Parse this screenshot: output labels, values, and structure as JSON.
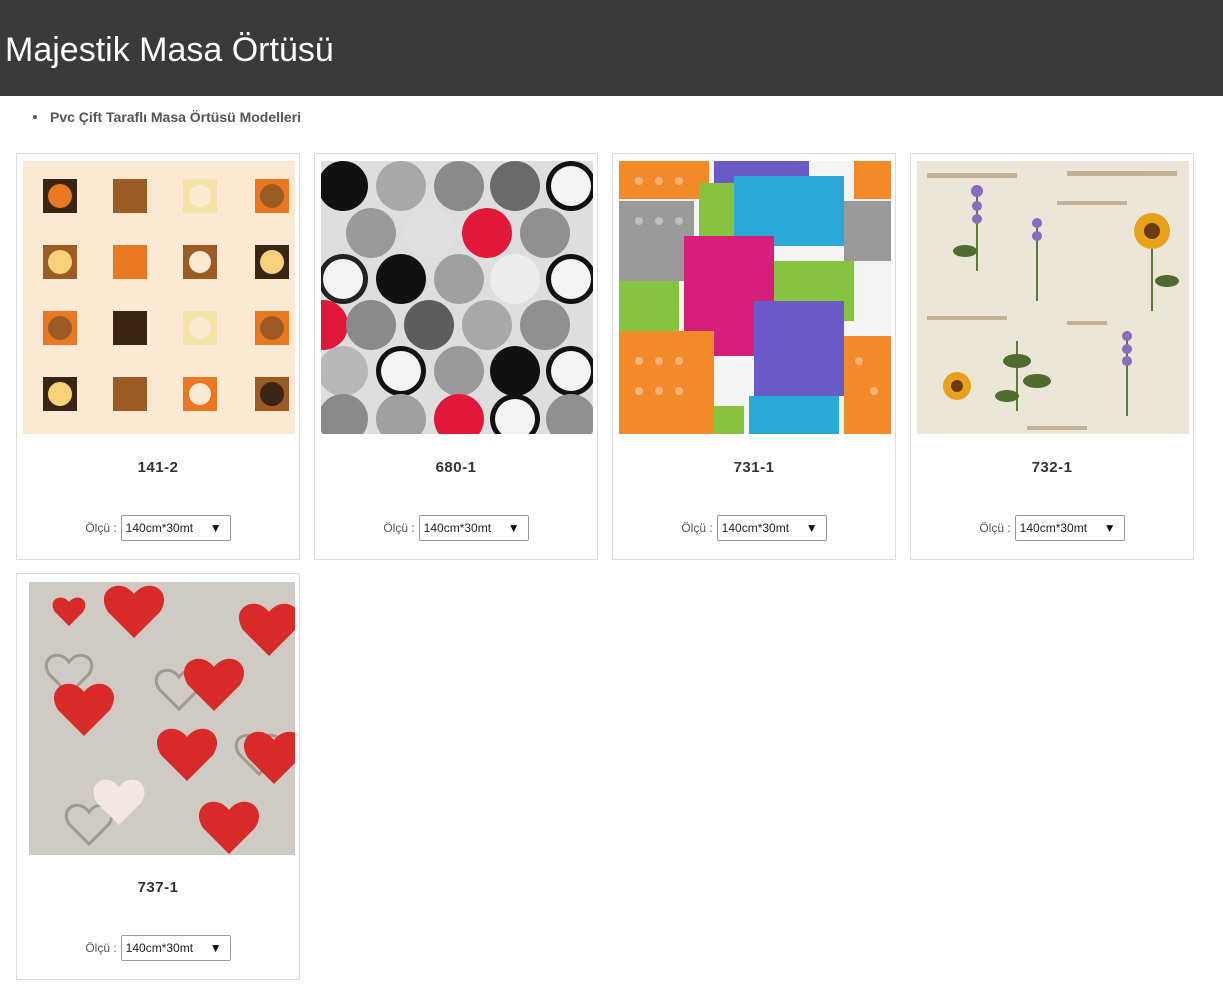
{
  "page": {
    "title": "Majestik Masa Örtüsü"
  },
  "breadcrumb": {
    "category": "Pvc Çift Taraflı Masa Örtüsü Modelleri"
  },
  "size_label": "Ölçü :",
  "products": [
    {
      "code": "141-2",
      "size": "140cm*30mt",
      "pattern": "squares-and-circles"
    },
    {
      "code": "680-1",
      "size": "140cm*30mt",
      "pattern": "circles-and-leaves"
    },
    {
      "code": "731-1",
      "size": "140cm*30mt",
      "pattern": "colorful-patchwork"
    },
    {
      "code": "732-1",
      "size": "140cm*30mt",
      "pattern": "botanical-print"
    },
    {
      "code": "737-1",
      "size": "140cm*30mt",
      "pattern": "red-hearts"
    }
  ]
}
